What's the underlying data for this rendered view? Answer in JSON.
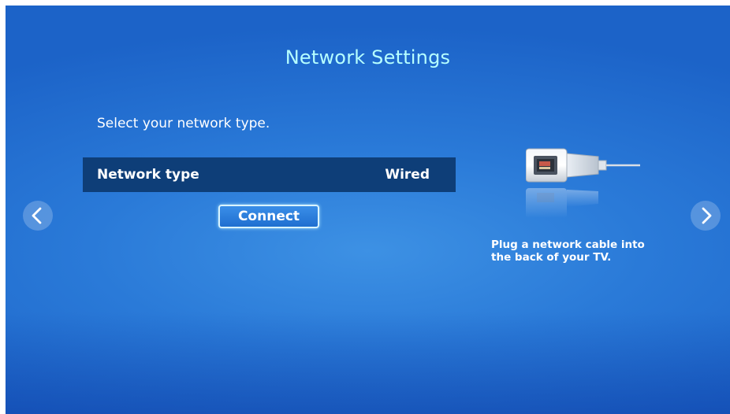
{
  "header": {
    "title": "Network Settings"
  },
  "main": {
    "prompt": "Select your network type.",
    "network_type": {
      "label": "Network type",
      "value": "Wired"
    },
    "connect_label": "Connect"
  },
  "help": {
    "text": "Plug a network cable into\nthe back of your TV.",
    "illustration_icon": "ethernet-cable-icon"
  },
  "navigation": {
    "previous_icon": "chevron-left-icon",
    "next_icon": "chevron-right-icon"
  },
  "colors": {
    "background": "#2a7ad8",
    "title": "#b6ffff",
    "row_selected": "#0e3e78",
    "button_border": "#d9f4ff"
  }
}
